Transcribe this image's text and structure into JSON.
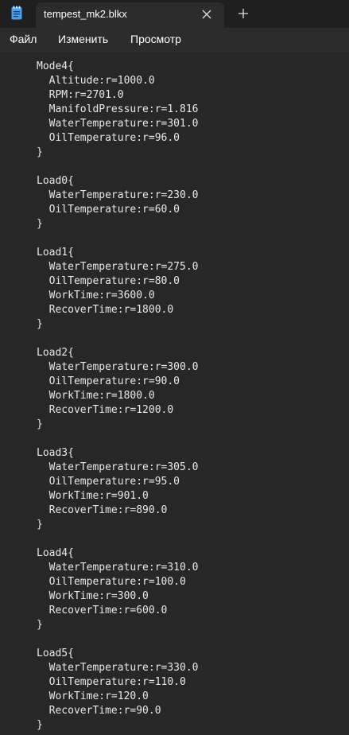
{
  "tab": {
    "title": "tempest_mk2.blkx"
  },
  "menu": {
    "file": "Файл",
    "edit": "Изменить",
    "view": "Просмотр"
  },
  "editor": {
    "lines": [
      "Mode4{",
      "  Altitude:r=1000.0",
      "  RPM:r=2701.0",
      "  ManifoldPressure:r=1.816",
      "  WaterTemperature:r=301.0",
      "  OilTemperature:r=96.0",
      "}",
      "",
      "Load0{",
      "  WaterTemperature:r=230.0",
      "  OilTemperature:r=60.0",
      "}",
      "",
      "Load1{",
      "  WaterTemperature:r=275.0",
      "  OilTemperature:r=80.0",
      "  WorkTime:r=3600.0",
      "  RecoverTime:r=1800.0",
      "}",
      "",
      "Load2{",
      "  WaterTemperature:r=300.0",
      "  OilTemperature:r=90.0",
      "  WorkTime:r=1800.0",
      "  RecoverTime:r=1200.0",
      "}",
      "",
      "Load3{",
      "  WaterTemperature:r=305.0",
      "  OilTemperature:r=95.0",
      "  WorkTime:r=901.0",
      "  RecoverTime:r=890.0",
      "}",
      "",
      "Load4{",
      "  WaterTemperature:r=310.0",
      "  OilTemperature:r=100.0",
      "  WorkTime:r=300.0",
      "  RecoverTime:r=600.0",
      "}",
      "",
      "Load5{",
      "  WaterTemperature:r=330.0",
      "  OilTemperature:r=110.0",
      "  WorkTime:r=120.0",
      "  RecoverTime:r=90.0",
      "}"
    ]
  },
  "icons": {
    "app": "notepad-icon",
    "close": "close-icon",
    "new_tab": "plus-icon"
  },
  "colors": {
    "accent": "#4aa0f0",
    "background": "#272727",
    "text": "#e8e8e8"
  }
}
